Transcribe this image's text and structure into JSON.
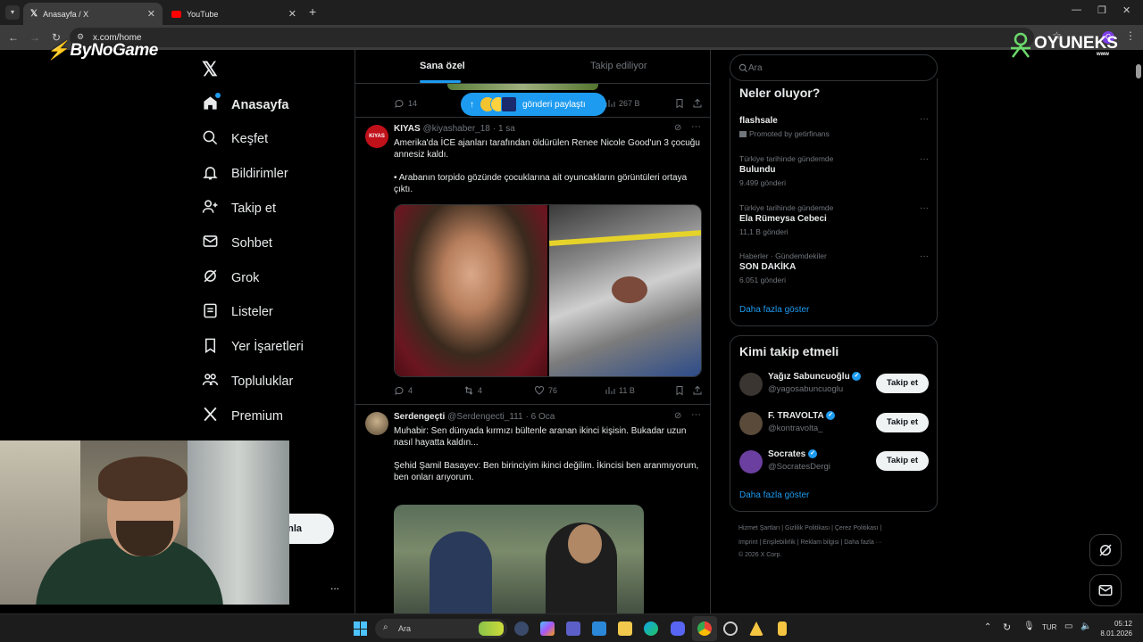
{
  "browser": {
    "tabs": [
      {
        "title": "Anasayfa / X",
        "active": true
      },
      {
        "title": "YouTube",
        "active": false
      }
    ],
    "url": "x.com/home",
    "profile_initial": "C"
  },
  "overlays": {
    "left_logo": "ByNoGame",
    "right_logo": "OYUNEKS",
    "right_logo_sub": "www"
  },
  "sidebar": {
    "items": [
      {
        "label": "Anasayfa",
        "icon": "home-icon"
      },
      {
        "label": "Keşfet",
        "icon": "search-icon"
      },
      {
        "label": "Bildirimler",
        "icon": "bell-icon"
      },
      {
        "label": "Takip et",
        "icon": "add-person-icon"
      },
      {
        "label": "Sohbet",
        "icon": "mail-icon"
      },
      {
        "label": "Grok",
        "icon": "grok-icon"
      },
      {
        "label": "Listeler",
        "icon": "list-icon"
      },
      {
        "label": "Yer İşaretleri",
        "icon": "bookmark-icon"
      },
      {
        "label": "Topluluklar",
        "icon": "communities-icon"
      },
      {
        "label": "Premium",
        "icon": "x-logo-icon"
      }
    ],
    "post_button_partial": "nla",
    "more": "..."
  },
  "feed": {
    "tabs": [
      "Sana özel",
      "Takip ediliyor"
    ],
    "new_posts_pill": "gönderi paylaştı",
    "top_tweet_actions": {
      "replies": "14",
      "views": "267 B"
    },
    "tweets": [
      {
        "name": "KIYAS",
        "handle": "@kiyashaber_18",
        "time": "· 1 sa",
        "avatar_text": "KIYAS",
        "text": "Amerika'da İCE ajanları tarafından öldürülen Renee Nicole Good'un 3 çocuğu annesiz kaldı.\n\n• Arabanın torpido gözünde çocuklarına ait oyuncakların görüntüleri ortaya çıktı.",
        "replies": "4",
        "reposts": "4",
        "likes": "76",
        "views": "11 B"
      },
      {
        "name": "Serdengeçti",
        "handle": "@Serdengecti_111",
        "time": "· 6 Oca",
        "text": "Muhabir: Sen dünyada kırmızı bültenle aranan ikinci kişisin. Bukadar uzun nasıl hayatta kaldın...\n\nŞehid Şamil Basayev: Ben birinciyim ikinci değilim. İkincisi ben aranmıyorum,\nben onları arıyorum."
      }
    ]
  },
  "right": {
    "search_placeholder": "Ara",
    "trends_title": "Neler oluyor?",
    "trends": [
      {
        "meta": "",
        "title": "flashsale",
        "count": "Promoted by getirfinans"
      },
      {
        "meta": "Türkiye tarihinde gündemde",
        "title": "Bulundu",
        "count": "9.499 gönderi"
      },
      {
        "meta": "Türkiye tarihinde gündemde",
        "title": "Ela Rümeysa Cebeci",
        "count": "11,1 B gönderi"
      },
      {
        "meta": "Haberler · Gündemdekiler",
        "title": "SON DAKİKA",
        "count": "6.051 gönderi"
      }
    ],
    "trends_more": "Daha fazla göster",
    "wtf_title": "Kimi takip etmeli",
    "who_to_follow": [
      {
        "name": "Yağız Sabuncuoğlu",
        "handle": "@yagosabuncuoglu",
        "button": "Takip et",
        "avatar_color": "#3a3530"
      },
      {
        "name": "F. TRAVOLTA",
        "handle": "@kontravolta_",
        "button": "Takip et",
        "avatar_color": "#5a4a3a"
      },
      {
        "name": "Socrates",
        "handle": "@SocratesDergi",
        "button": "Takip et",
        "avatar_color": "#6b3fa0"
      }
    ],
    "wtf_more": "Daha fazla göster",
    "footer_line1": "Hizmet Şartları  |  Gizlilik Politikası  |  Çerez Politikası  |",
    "footer_line2": "Imprint  |  Erişilebilirlik  |  Reklam bilgisi  |  Daha fazla ···",
    "footer_line3": "© 2026 X Corp."
  },
  "taskbar": {
    "search": "Ara",
    "lang": "TUR",
    "time": "05:12",
    "date": "8.01.2026"
  }
}
